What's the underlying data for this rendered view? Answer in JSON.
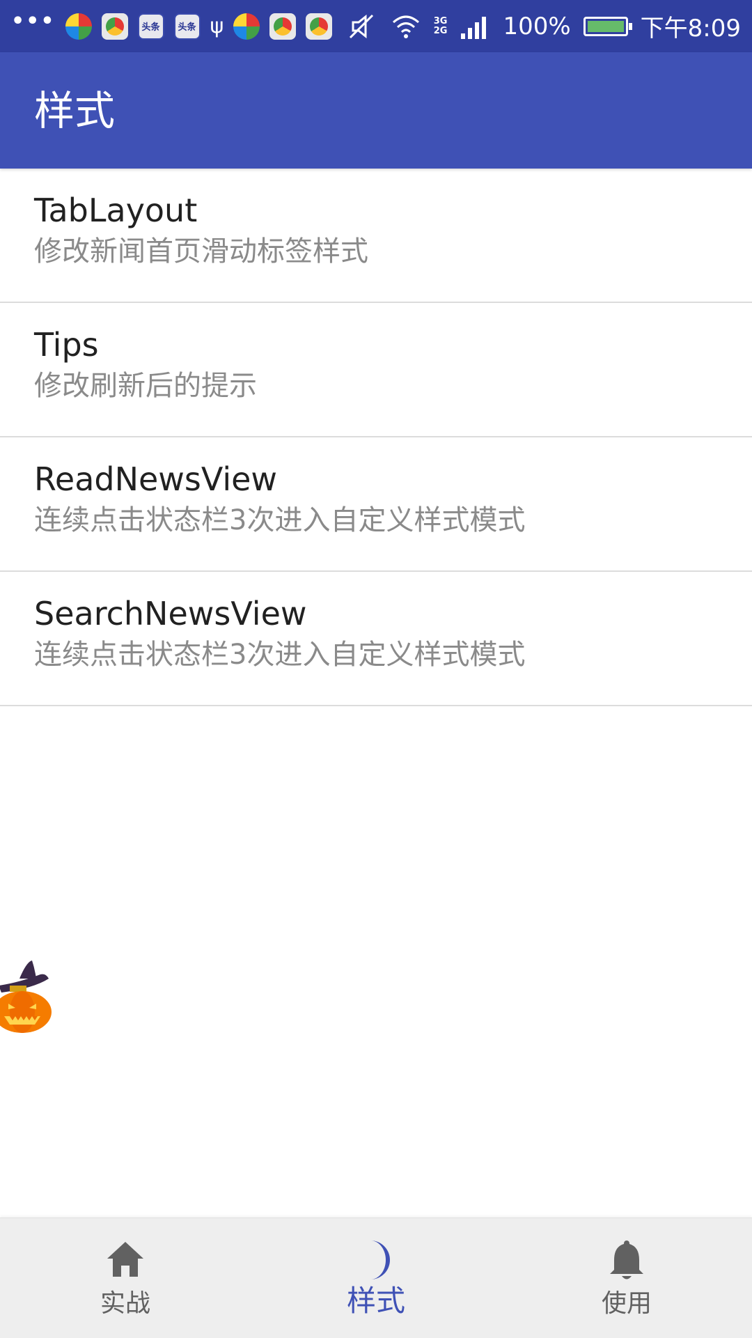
{
  "status_bar": {
    "battery": "100%",
    "time": "下午8:09",
    "network": [
      "3G",
      "2G"
    ],
    "notification_icons": [
      "more-icon",
      "app-icon",
      "browser-icon",
      "toutiao-icon",
      "toutiao-icon",
      "usb-icon",
      "app-icon",
      "browser-icon",
      "browser-icon"
    ],
    "toutiao_label": "头条"
  },
  "app_bar": {
    "title": "样式"
  },
  "list": {
    "items": [
      {
        "title": "TabLayout",
        "description": "修改新闻首页滑动标签样式"
      },
      {
        "title": "Tips",
        "description": "修改刷新后的提示"
      },
      {
        "title": "ReadNewsView",
        "description": "连续点击状态栏3次进入自定义样式模式"
      },
      {
        "title": "SearchNewsView",
        "description": "连续点击状态栏3次进入自定义样式模式"
      }
    ]
  },
  "bottom_nav": {
    "items": [
      {
        "label": "实战",
        "icon": "home-icon",
        "active": false
      },
      {
        "label": "样式",
        "icon": "moon-icon",
        "active": true
      },
      {
        "label": "使用",
        "icon": "bell-icon",
        "active": false
      }
    ]
  },
  "colors": {
    "status_bar": "#303f9f",
    "primary": "#3f51b5",
    "nav_background": "#eeeeee",
    "inactive_icon": "#616161"
  }
}
